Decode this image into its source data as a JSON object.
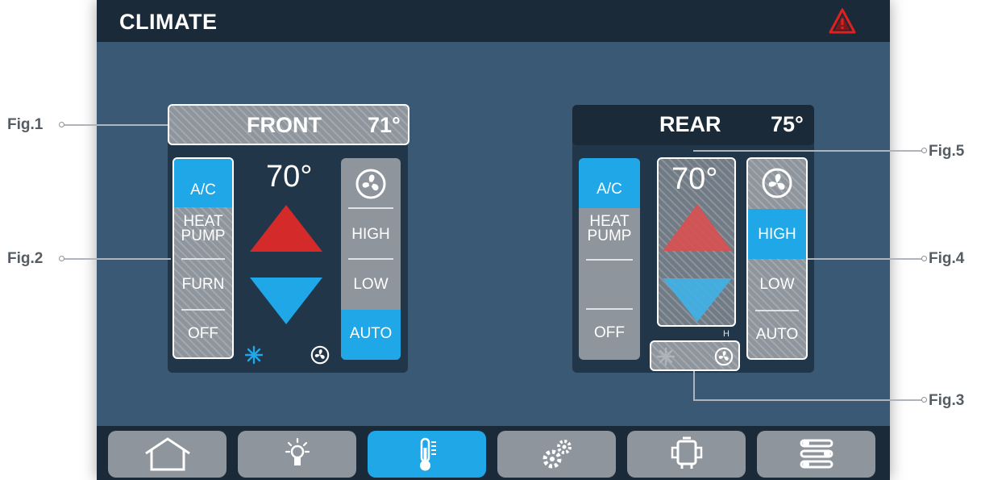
{
  "header": {
    "title": "CLIMATE",
    "alert_icon": "warning-triangle-icon",
    "alert_color": "#e02020"
  },
  "front": {
    "zone_label": "FRONT",
    "zone_temp": "71°",
    "setpoint": "70°",
    "modes": [
      "A/C",
      "HEAT\nPUMP",
      "FURN",
      "OFF"
    ],
    "modes_display": {
      "ac": "A/C",
      "heat1": "HEAT",
      "heat2": "PUMP",
      "furn": "FURN",
      "off": "OFF"
    },
    "selected_mode": "A/C",
    "fan": {
      "icon": "fan-icon",
      "speeds": {
        "high": "HIGH",
        "low": "LOW",
        "auto": "AUTO"
      },
      "selected_speed": "AUTO"
    },
    "status_icons": [
      "snowflake-icon",
      "fan-icon"
    ]
  },
  "rear": {
    "zone_label": "REAR",
    "zone_temp": "75°",
    "setpoint": "70°",
    "modes_display": {
      "ac": "A/C",
      "heat1": "HEAT",
      "heat2": "PUMP",
      "off": "OFF"
    },
    "selected_mode": "A/C",
    "fan": {
      "icon": "fan-icon",
      "speeds": {
        "high": "HIGH",
        "low": "LOW",
        "auto": "AUTO"
      },
      "selected_speed": "HIGH"
    },
    "status_icons": [
      "snowflake-icon",
      "fan-icon"
    ],
    "status_fan_level": "H"
  },
  "navbar": {
    "items": [
      {
        "icon": "home-icon",
        "active": false
      },
      {
        "icon": "lightbulb-icon",
        "active": false
      },
      {
        "icon": "thermometer-icon",
        "active": true
      },
      {
        "icon": "gears-icon",
        "active": false
      },
      {
        "icon": "generator-icon",
        "active": false
      },
      {
        "icon": "sliders-icon",
        "active": false
      }
    ]
  },
  "callouts": {
    "fig1": "Fig.1",
    "fig2": "Fig.2",
    "fig3": "Fig.3",
    "fig4": "Fig.4",
    "fig5": "Fig.5"
  },
  "colors": {
    "background": "#3a5975",
    "titlebar": "#1b2a38",
    "accent_blue": "#1fa7e8",
    "up_red": "#d42a2a",
    "down_blue": "#1fa7e8",
    "button_gray": "#8e959c"
  }
}
